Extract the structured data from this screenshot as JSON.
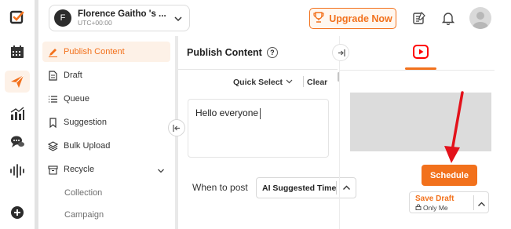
{
  "colors": {
    "accent": "#f2711c",
    "arrow": "#e3121b",
    "youtube": "#ff0000"
  },
  "rail": {
    "items": [
      {
        "name": "dashboard-check-icon"
      },
      {
        "name": "calendar-icon"
      },
      {
        "name": "publish-send-icon",
        "active": true
      },
      {
        "name": "analytics-icon"
      },
      {
        "name": "engage-chat-icon"
      },
      {
        "name": "listening-waves-icon"
      },
      {
        "name": "add-circle-icon"
      }
    ]
  },
  "account": {
    "name": "Florence Gaitho 's ...",
    "timezone": "UTC+00:00",
    "initial": "F"
  },
  "header": {
    "upgrade_label": "Upgrade Now"
  },
  "sidebar": {
    "items": [
      {
        "label": "Publish Content",
        "icon": "pencil-icon",
        "active": true
      },
      {
        "label": "Draft",
        "icon": "draft-icon"
      },
      {
        "label": "Queue",
        "icon": "queue-icon"
      },
      {
        "label": "Suggestion",
        "icon": "bookmark-icon"
      },
      {
        "label": "Bulk Upload",
        "icon": "layers-icon"
      },
      {
        "label": "Recycle",
        "icon": "archive-icon"
      }
    ],
    "sub_items": [
      {
        "label": "Collection"
      },
      {
        "label": "Campaign"
      }
    ]
  },
  "publish": {
    "title": "Publish Content",
    "help": "?",
    "quick_select": "Quick Select",
    "clear": "Clear",
    "editor_text": "Hello everyone",
    "when_label": "When to post",
    "when_value": "AI Suggested Time"
  },
  "preview": {
    "active_tab": "youtube-icon"
  },
  "actions": {
    "schedule": "Schedule",
    "save_draft": "Save Draft",
    "visibility": "Only Me"
  }
}
